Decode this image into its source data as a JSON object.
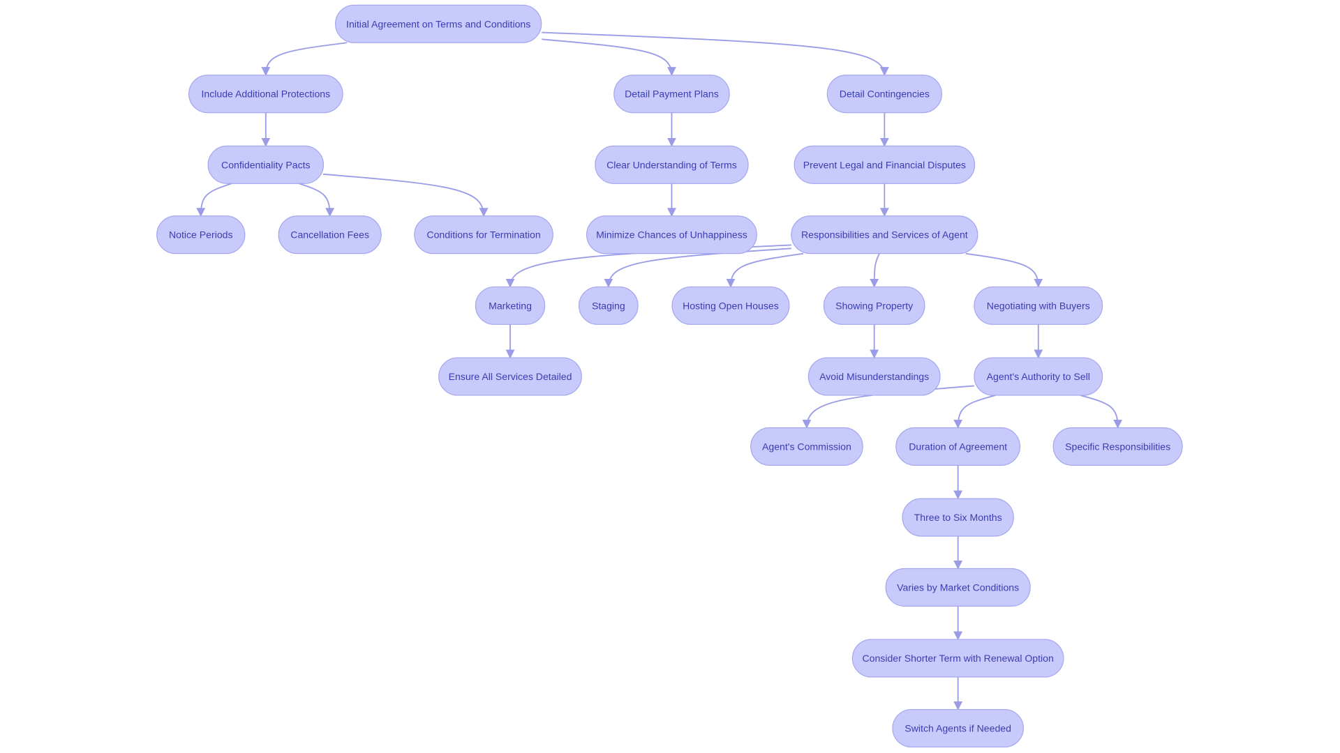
{
  "diagram": {
    "type": "flowchart",
    "colors": {
      "node_fill": "#c8cafb",
      "node_border": "#a4a7ef",
      "text": "#3a3db0",
      "edge": "#9a9de6"
    },
    "nodes": [
      {
        "id": "n0",
        "label": "Initial Agreement on Terms and Conditions"
      },
      {
        "id": "n1",
        "label": "Include Additional Protections"
      },
      {
        "id": "n2",
        "label": "Detail Payment Plans"
      },
      {
        "id": "n3",
        "label": "Detail Contingencies"
      },
      {
        "id": "n4",
        "label": "Confidentiality Pacts"
      },
      {
        "id": "n5",
        "label": "Clear Understanding of Terms"
      },
      {
        "id": "n6",
        "label": "Prevent Legal and Financial Disputes"
      },
      {
        "id": "n7",
        "label": "Notice Periods"
      },
      {
        "id": "n8",
        "label": "Cancellation Fees"
      },
      {
        "id": "n9",
        "label": "Conditions for Termination"
      },
      {
        "id": "n10",
        "label": "Minimize Chances of Unhappiness"
      },
      {
        "id": "n11",
        "label": "Responsibilities and Services of Agent"
      },
      {
        "id": "n12",
        "label": "Marketing"
      },
      {
        "id": "n13",
        "label": "Staging"
      },
      {
        "id": "n14",
        "label": "Hosting Open Houses"
      },
      {
        "id": "n15",
        "label": "Showing Property"
      },
      {
        "id": "n16",
        "label": "Negotiating with Buyers"
      },
      {
        "id": "n17",
        "label": "Ensure All Services Detailed"
      },
      {
        "id": "n18",
        "label": "Avoid Misunderstandings"
      },
      {
        "id": "n19",
        "label": "Agent's Authority to Sell"
      },
      {
        "id": "n20",
        "label": "Agent's Commission"
      },
      {
        "id": "n21",
        "label": "Duration of Agreement"
      },
      {
        "id": "n22",
        "label": "Specific Responsibilities"
      },
      {
        "id": "n23",
        "label": "Three to Six Months"
      },
      {
        "id": "n24",
        "label": "Varies by Market Conditions"
      },
      {
        "id": "n25",
        "label": "Consider Shorter Term with Renewal Option"
      },
      {
        "id": "n26",
        "label": "Switch Agents if Needed"
      }
    ],
    "edges": [
      [
        "n0",
        "n1"
      ],
      [
        "n0",
        "n2"
      ],
      [
        "n0",
        "n3"
      ],
      [
        "n1",
        "n4"
      ],
      [
        "n2",
        "n5"
      ],
      [
        "n3",
        "n6"
      ],
      [
        "n4",
        "n7"
      ],
      [
        "n4",
        "n8"
      ],
      [
        "n4",
        "n9"
      ],
      [
        "n5",
        "n10"
      ],
      [
        "n6",
        "n11"
      ],
      [
        "n11",
        "n12"
      ],
      [
        "n11",
        "n13"
      ],
      [
        "n11",
        "n14"
      ],
      [
        "n11",
        "n15"
      ],
      [
        "n11",
        "n16"
      ],
      [
        "n12",
        "n17"
      ],
      [
        "n15",
        "n18"
      ],
      [
        "n16",
        "n19"
      ],
      [
        "n19",
        "n20"
      ],
      [
        "n19",
        "n21"
      ],
      [
        "n19",
        "n22"
      ],
      [
        "n21",
        "n23"
      ],
      [
        "n23",
        "n24"
      ],
      [
        "n24",
        "n25"
      ],
      [
        "n25",
        "n26"
      ]
    ]
  }
}
